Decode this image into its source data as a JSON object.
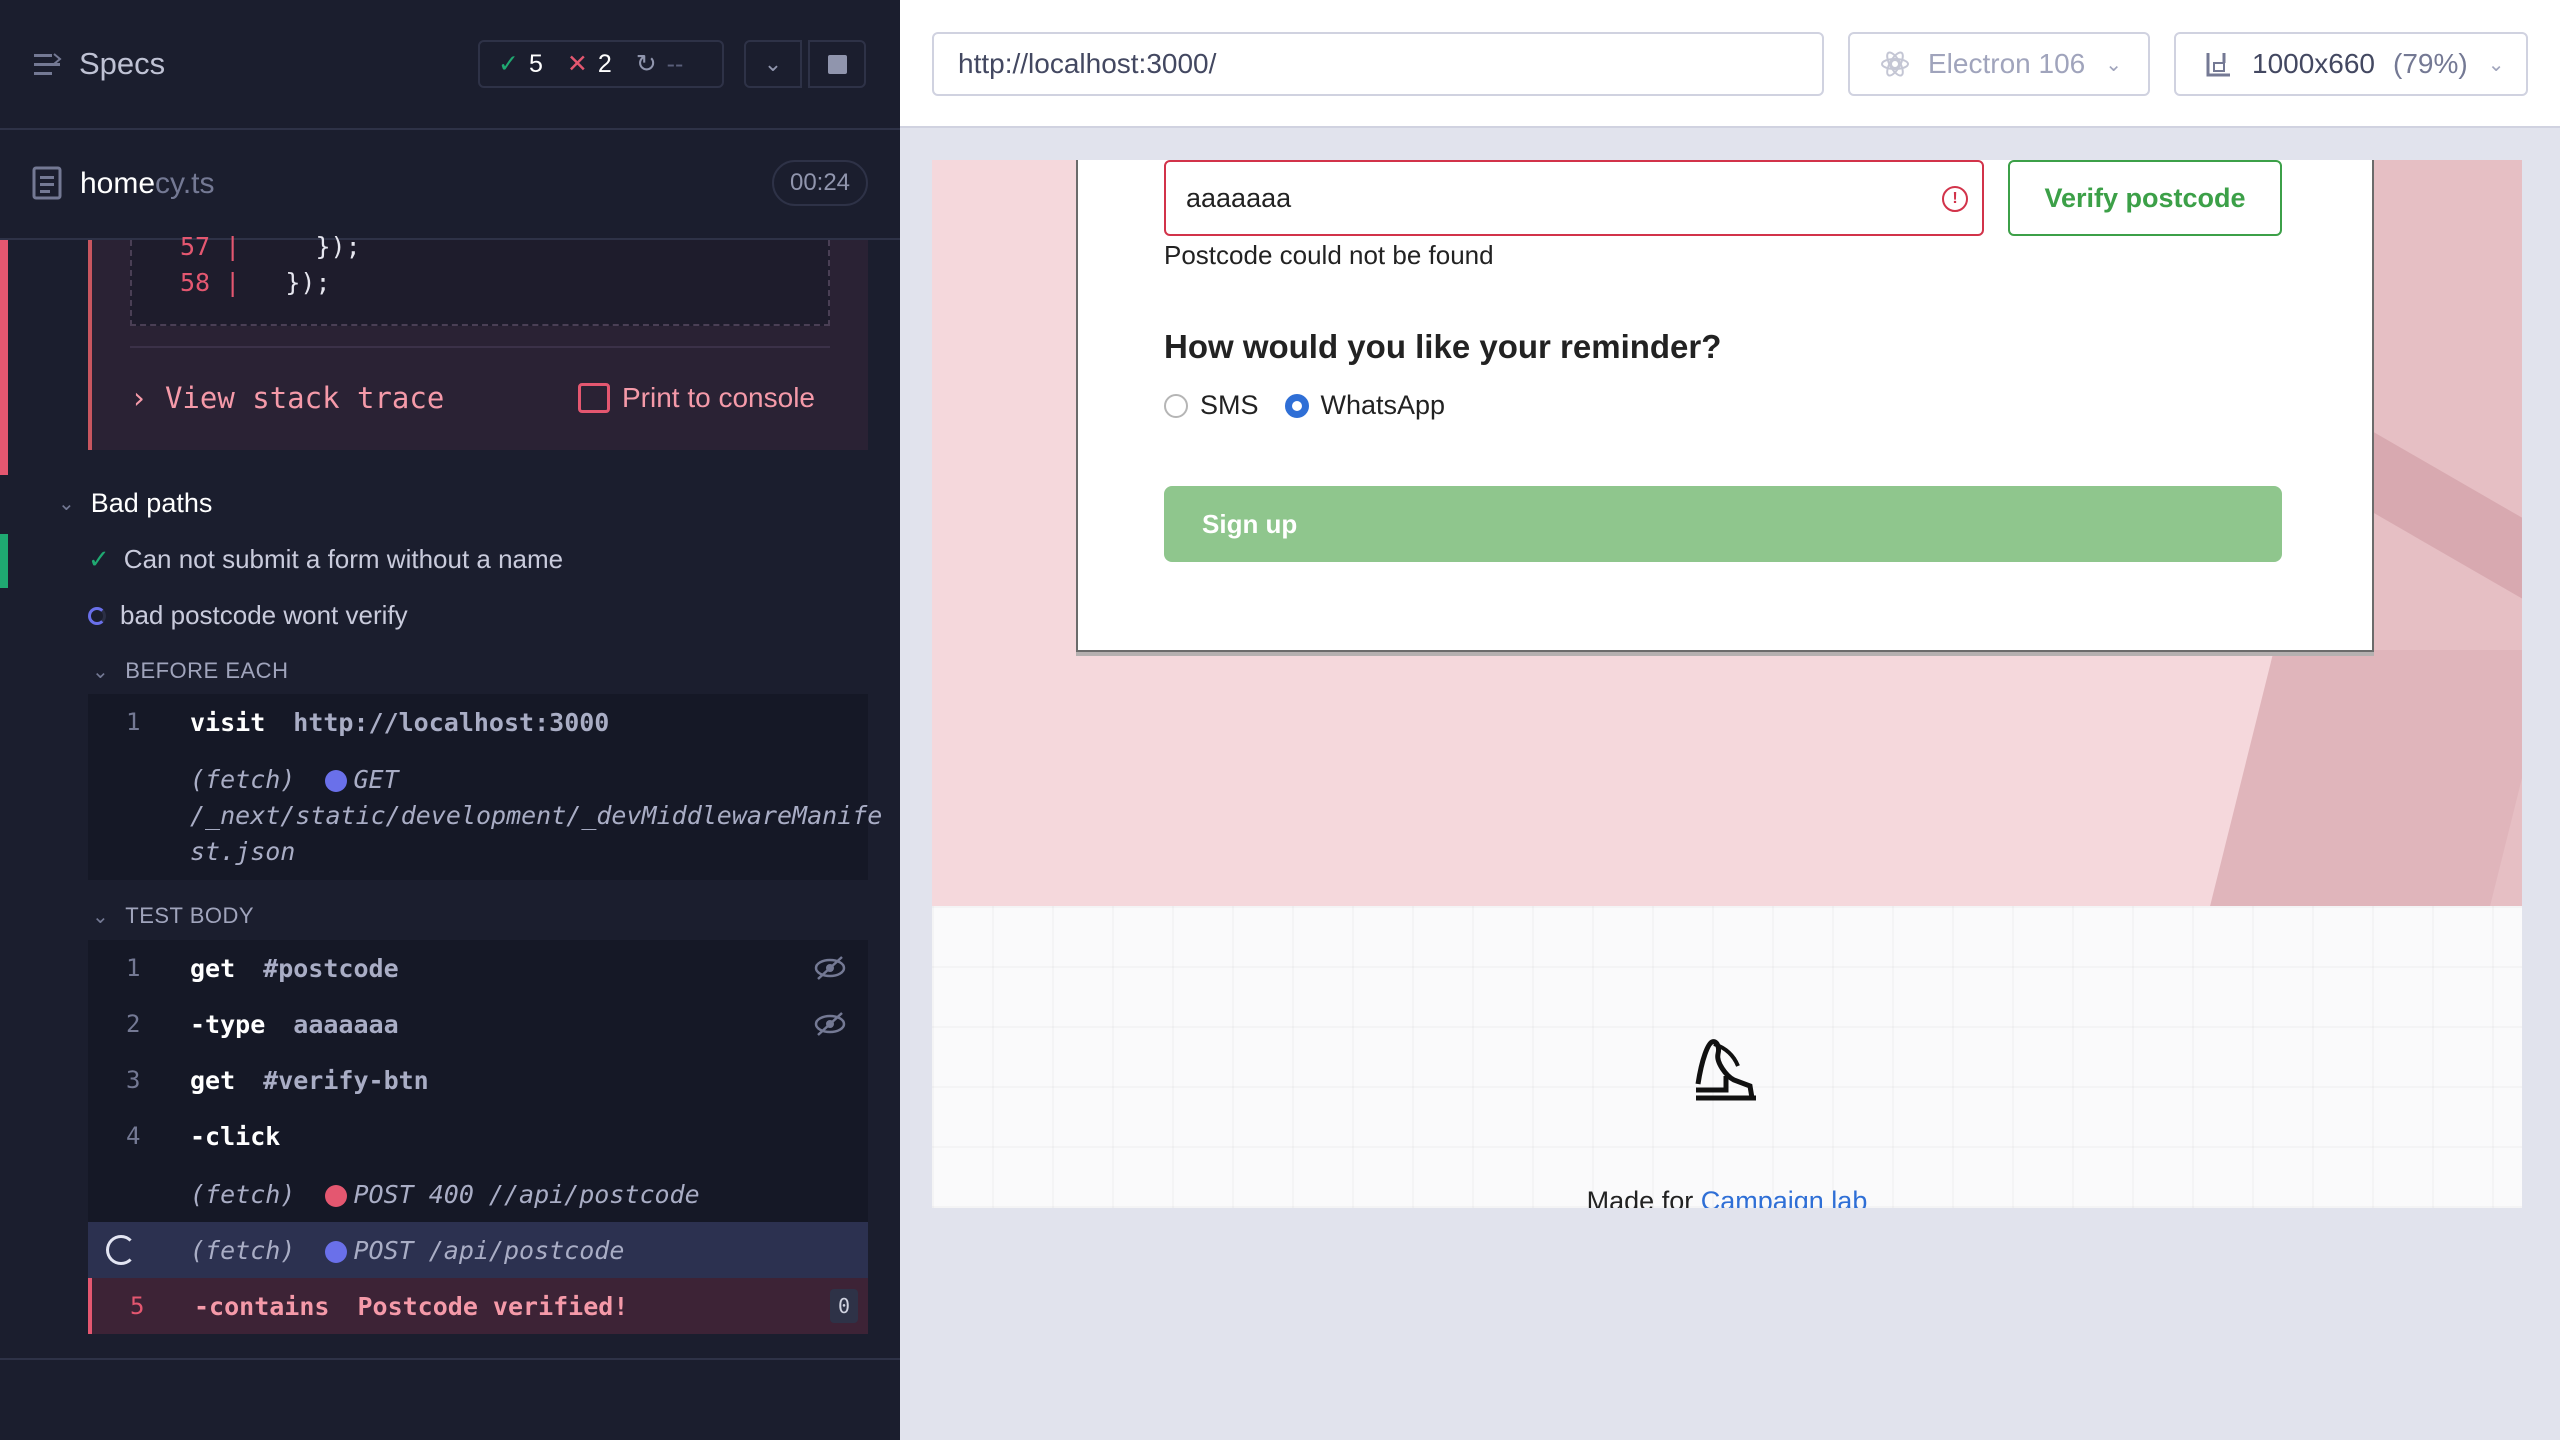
{
  "runner": {
    "specs_title": "Specs",
    "stats": {
      "passed": "5",
      "failed": "2",
      "pending": "--"
    },
    "file": {
      "name": "home",
      "ext": "cy.ts",
      "duration": "00:24"
    },
    "error": {
      "code_lines": [
        {
          "num": "57",
          "text": "    });"
        },
        {
          "num": "58",
          "text": "  });"
        }
      ],
      "stack_trace_label": "View stack trace",
      "print_console_label": "Print to console"
    },
    "suite": {
      "title": "Bad paths"
    },
    "tests": [
      {
        "title": "Can not submit a form without a name",
        "state": "passed"
      },
      {
        "title": "bad postcode wont verify",
        "state": "running"
      }
    ],
    "before_each": {
      "label": "BEFORE EACH",
      "commands": [
        {
          "num": "1",
          "name": "visit",
          "message": "http://localhost:3000"
        }
      ],
      "fetch": {
        "prefix": "(fetch)",
        "method": "GET",
        "path_line1": "/_next/static/development/_devMiddlewareManife",
        "path_line2": "st.json"
      }
    },
    "test_body": {
      "label": "TEST BODY",
      "commands": [
        {
          "num": "1",
          "name": "get",
          "message": "#postcode"
        },
        {
          "num": "2",
          "name": "-type",
          "message": "aaaaaaa"
        },
        {
          "num": "3",
          "name": "get",
          "message": "#verify-btn"
        },
        {
          "num": "4",
          "name": "-click",
          "message": ""
        },
        {
          "num": "5",
          "name": "-contains",
          "message": "Postcode verified!",
          "count": "0"
        }
      ],
      "fetch_fail": {
        "prefix": "(fetch)",
        "text": "POST 400 //api/postcode"
      },
      "fetch_pending": {
        "prefix": "(fetch)",
        "text": "POST /api/postcode"
      }
    }
  },
  "aut": {
    "url": "http://localhost:3000/",
    "browser": "Electron 106",
    "viewport": {
      "size": "1000x660",
      "scale": "(79%)"
    },
    "form": {
      "postcode_value": "aaaaaaa",
      "verify_label": "Verify postcode",
      "error_text": "Postcode could not be found",
      "reminder_heading": "How would you like your reminder?",
      "radio_options": [
        {
          "label": "SMS",
          "checked": false
        },
        {
          "label": "WhatsApp",
          "checked": true
        }
      ],
      "signup_label": "Sign up"
    },
    "footer": {
      "made_for": "Made for",
      "link": "Campaign lab"
    }
  },
  "colors": {
    "pass": "#1fa971",
    "fail": "#e45770",
    "accent": "#6a70ea",
    "signup_green": "#8fc68d",
    "error_red": "#d2334a"
  },
  "icons": [
    "menu-icon",
    "check-icon",
    "x-icon",
    "spinner-icon",
    "chevron-down-icon",
    "stop-icon",
    "file-icon",
    "print-icon",
    "eye-slash-icon",
    "browser-icon",
    "viewport-icon",
    "warning-icon",
    "logo-icon"
  ]
}
